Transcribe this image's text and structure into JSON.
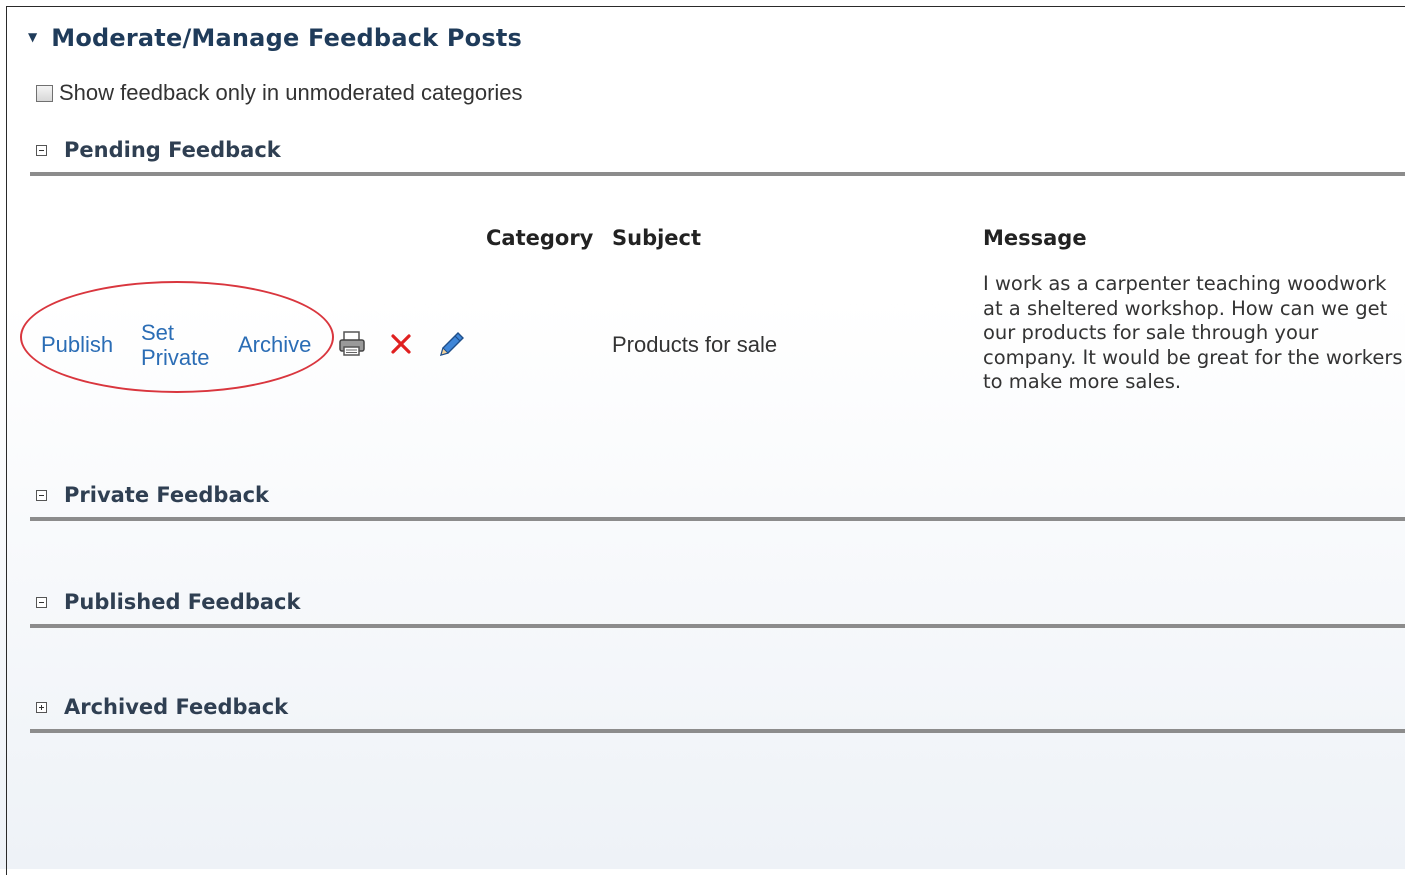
{
  "panel": {
    "title": "Moderate/Manage Feedback Posts",
    "expanded_icon": "triangle-down-icon"
  },
  "filter": {
    "checkbox_label": "Show feedback only in unmoderated categories",
    "checked": false
  },
  "sections": {
    "pending": {
      "title": "Pending Feedback",
      "state": "expanded"
    },
    "private": {
      "title": "Private Feedback",
      "state": "expanded"
    },
    "published": {
      "title": "Published Feedback",
      "state": "expanded"
    },
    "archived": {
      "title": "Archived Feedback",
      "state": "collapsed"
    }
  },
  "table": {
    "columns": [
      "Category",
      "Subject",
      "Message"
    ],
    "rows": [
      {
        "actions": [
          "Publish",
          "Set Private",
          "Archive"
        ],
        "action_icons": [
          "printer-icon",
          "delete-x-icon",
          "edit-pencil-icon"
        ],
        "category": "",
        "subject": "Products for sale",
        "message": "I work as a carpenter teaching woodwork at a sheltered workshop. How can we get our products for sale through your company. It would be great for the workers to make more sales."
      }
    ]
  },
  "colors": {
    "title": "#1f3b5a",
    "link": "#2b6db5",
    "delete": "#e02020",
    "annotation": "#d9363e",
    "divider": "#8c8c8c"
  }
}
